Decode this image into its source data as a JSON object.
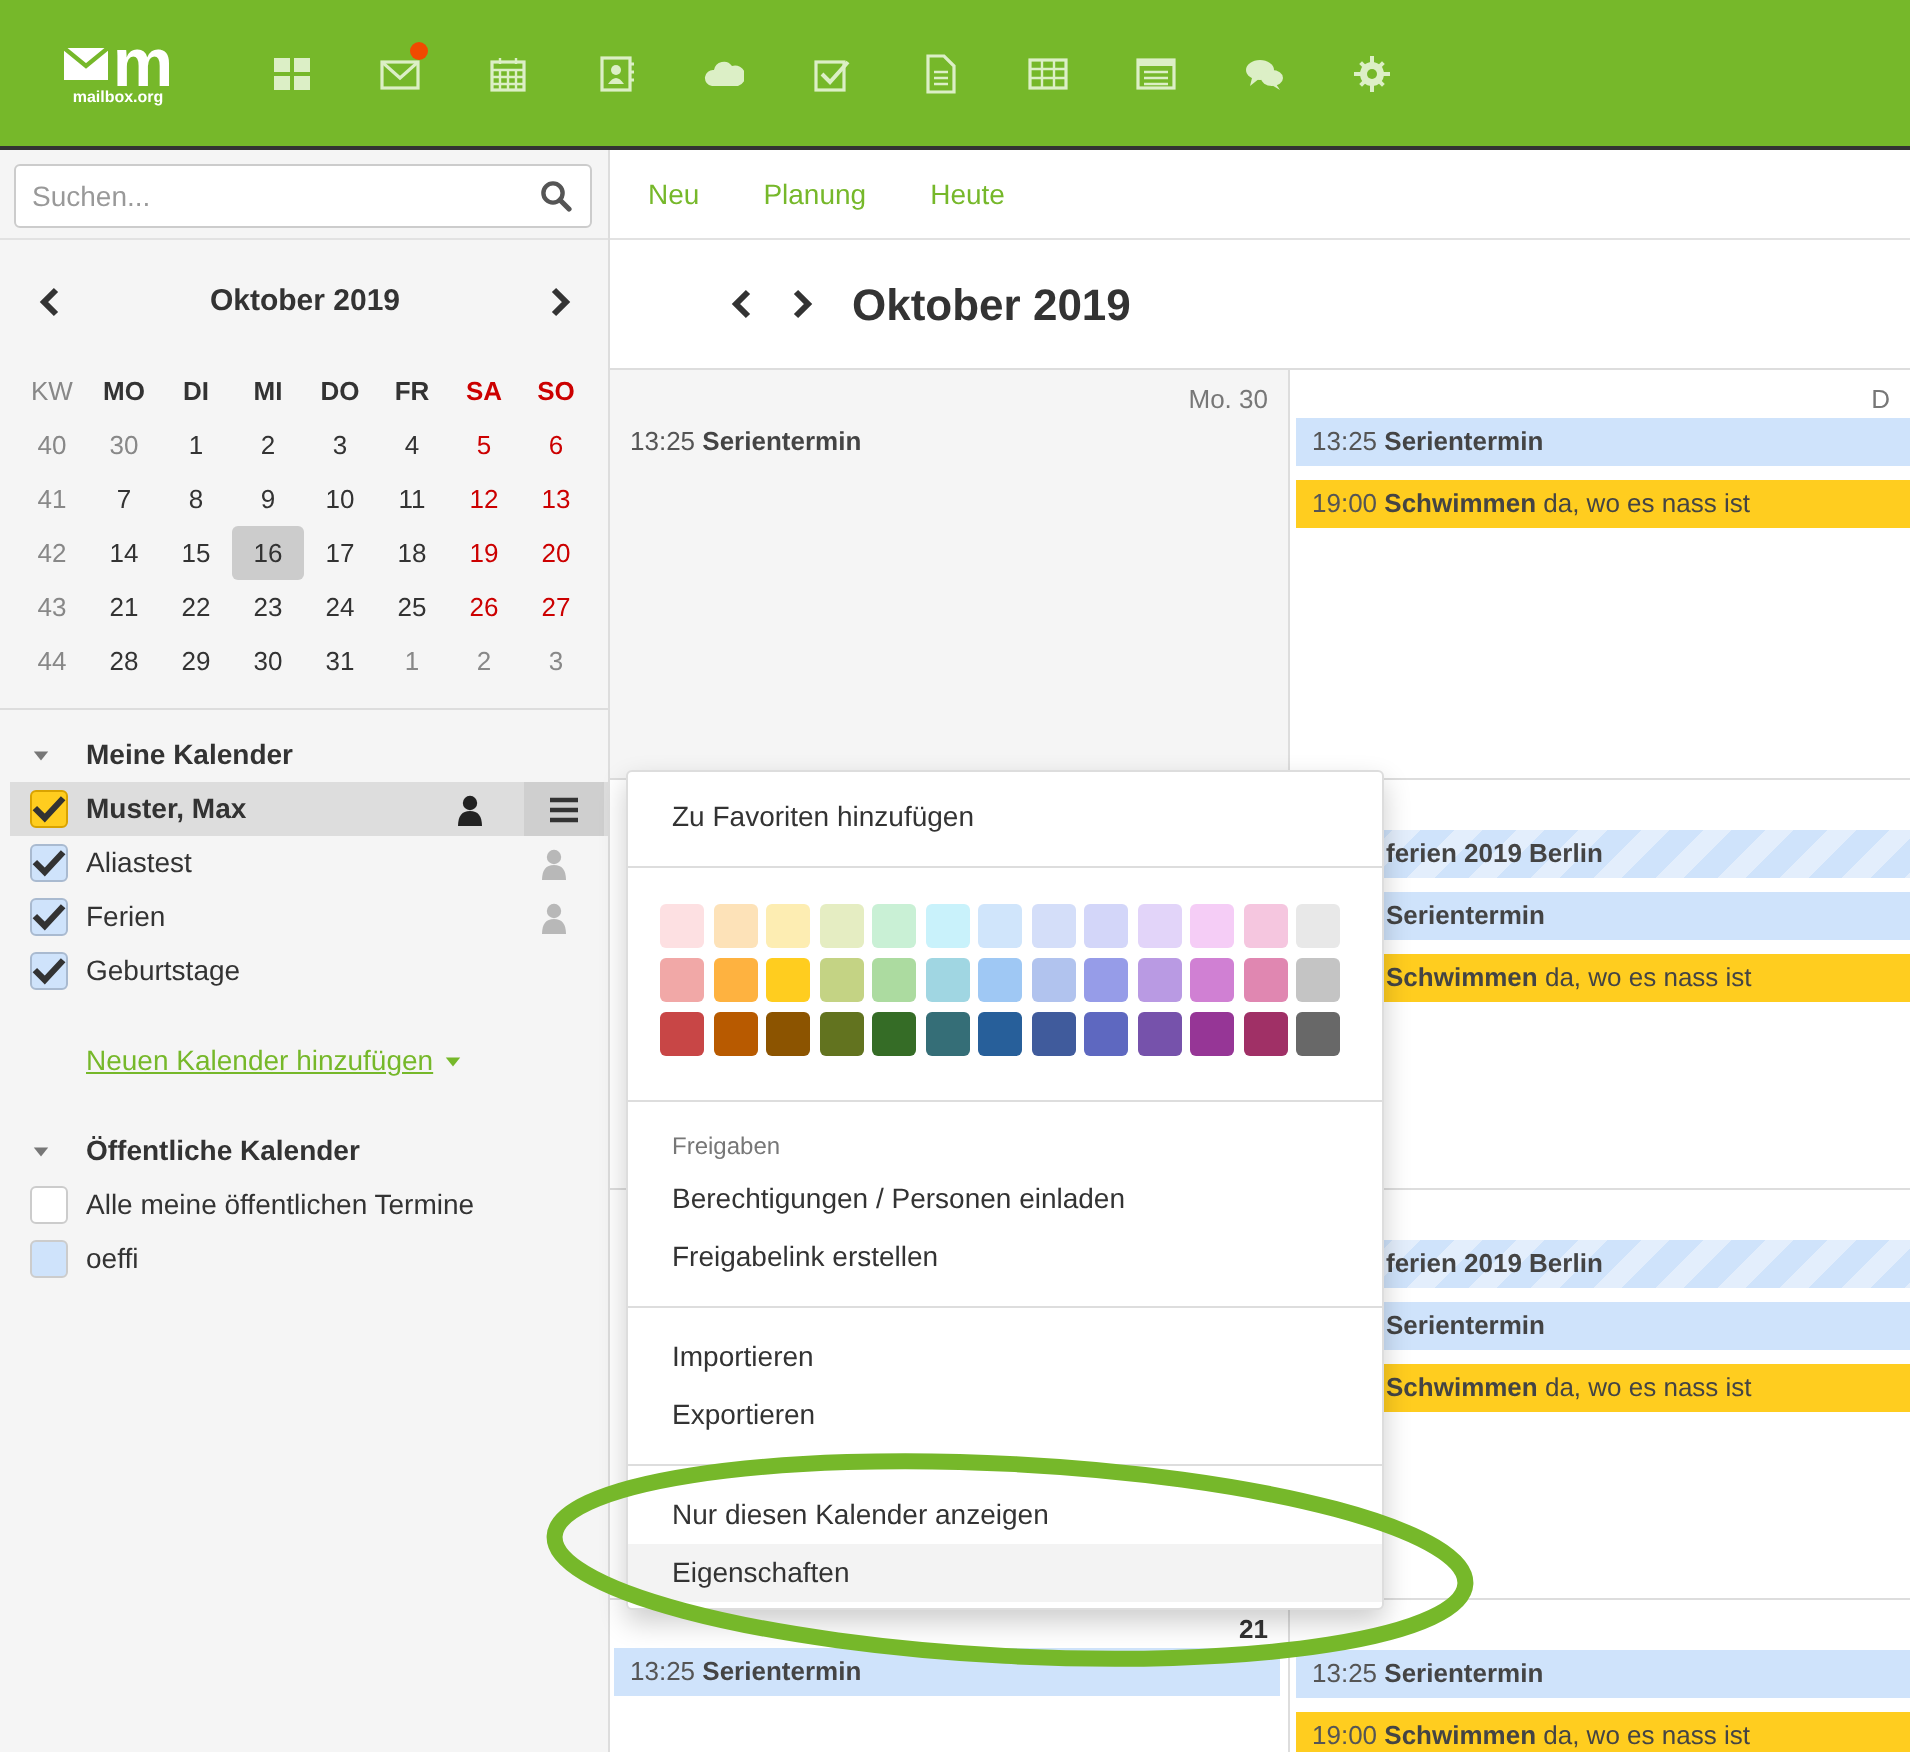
{
  "topbar": {
    "logo": {
      "mark": "m",
      "caption": "mailbox.org"
    },
    "apps": [
      {
        "kind": "portal",
        "notification": false
      },
      {
        "kind": "mail",
        "notification": true
      },
      {
        "kind": "calendar",
        "notification": false
      },
      {
        "kind": "contacts",
        "notification": false
      },
      {
        "kind": "cloud",
        "notification": false
      },
      {
        "kind": "tasks",
        "notification": false
      },
      {
        "kind": "document",
        "notification": false
      },
      {
        "kind": "spreadsheet",
        "notification": false
      },
      {
        "kind": "presentation",
        "notification": false
      },
      {
        "kind": "chat",
        "notification": false
      },
      {
        "kind": "settings",
        "notification": false
      }
    ]
  },
  "sidebar": {
    "search": {
      "placeholder": "Suchen..."
    },
    "minical": {
      "title": "Oktober 2019",
      "columns": [
        {
          "label": "KW",
          "kind": "week"
        },
        {
          "label": "MO",
          "kind": "weekday"
        },
        {
          "label": "DI",
          "kind": "weekday"
        },
        {
          "label": "MI",
          "kind": "weekday"
        },
        {
          "label": "DO",
          "kind": "weekday"
        },
        {
          "label": "FR",
          "kind": "weekday"
        },
        {
          "label": "SA",
          "kind": "weekend"
        },
        {
          "label": "SO",
          "kind": "weekend"
        }
      ],
      "weeks": [
        {
          "number": "40",
          "days": [
            {
              "label": "30",
              "muted": true,
              "selected": false
            },
            {
              "label": "1",
              "muted": false,
              "selected": false
            },
            {
              "label": "2",
              "muted": false,
              "selected": false
            },
            {
              "label": "3",
              "muted": false,
              "selected": false
            },
            {
              "label": "4",
              "muted": false,
              "selected": false
            },
            {
              "label": "5",
              "muted": false,
              "selected": false
            },
            {
              "label": "6",
              "muted": false,
              "selected": false
            }
          ]
        },
        {
          "number": "41",
          "days": [
            {
              "label": "7",
              "muted": false,
              "selected": false
            },
            {
              "label": "8",
              "muted": false,
              "selected": false
            },
            {
              "label": "9",
              "muted": false,
              "selected": false
            },
            {
              "label": "10",
              "muted": false,
              "selected": false
            },
            {
              "label": "11",
              "muted": false,
              "selected": false
            },
            {
              "label": "12",
              "muted": false,
              "selected": false
            },
            {
              "label": "13",
              "muted": false,
              "selected": false
            }
          ]
        },
        {
          "number": "42",
          "days": [
            {
              "label": "14",
              "muted": false,
              "selected": false
            },
            {
              "label": "15",
              "muted": false,
              "selected": false
            },
            {
              "label": "16",
              "muted": false,
              "selected": true
            },
            {
              "label": "17",
              "muted": false,
              "selected": false
            },
            {
              "label": "18",
              "muted": false,
              "selected": false
            },
            {
              "label": "19",
              "muted": false,
              "selected": false
            },
            {
              "label": "20",
              "muted": false,
              "selected": false
            }
          ]
        },
        {
          "number": "43",
          "days": [
            {
              "label": "21",
              "muted": false,
              "selected": false
            },
            {
              "label": "22",
              "muted": false,
              "selected": false
            },
            {
              "label": "23",
              "muted": false,
              "selected": false
            },
            {
              "label": "24",
              "muted": false,
              "selected": false
            },
            {
              "label": "25",
              "muted": false,
              "selected": false
            },
            {
              "label": "26",
              "muted": false,
              "selected": false
            },
            {
              "label": "27",
              "muted": false,
              "selected": false
            }
          ]
        },
        {
          "number": "44",
          "days": [
            {
              "label": "28",
              "muted": false,
              "selected": false
            },
            {
              "label": "29",
              "muted": false,
              "selected": false
            },
            {
              "label": "30",
              "muted": false,
              "selected": false
            },
            {
              "label": "31",
              "muted": false,
              "selected": false
            },
            {
              "label": "1",
              "muted": true,
              "selected": false
            },
            {
              "label": "2",
              "muted": true,
              "selected": false
            },
            {
              "label": "3",
              "muted": true,
              "selected": false
            }
          ]
        }
      ]
    },
    "sections": [
      {
        "title": "Meine Kalender",
        "expanded": true,
        "calendars": [
          {
            "name": "Muster, Max",
            "color": "#ffcd1f",
            "checked": true,
            "selected": true,
            "shared": true
          },
          {
            "name": "Aliastest",
            "color": "#cfe3fb",
            "checked": true,
            "selected": false,
            "shared": true
          },
          {
            "name": "Ferien",
            "color": "#cfe3fb",
            "checked": true,
            "selected": false,
            "shared": true
          },
          {
            "name": "Geburtstage",
            "color": "#cfe3fb",
            "checked": true,
            "selected": false,
            "shared": false
          }
        ],
        "link": "Neuen Kalender hinzufügen"
      },
      {
        "title": "Öffentliche Kalender",
        "expanded": true,
        "calendars": [
          {
            "name": "Alle meine öffentlichen Termine",
            "color": "#ffffff",
            "checked": false,
            "selected": false,
            "shared": false
          },
          {
            "name": "oeffi",
            "color": "#cfe3fb",
            "checked": false,
            "selected": false,
            "shared": false
          }
        ]
      }
    ]
  },
  "main": {
    "toolbar": [
      "Neu",
      "Planung",
      "Heute"
    ],
    "title": "Oktober 2019",
    "weeks": [
      {
        "days": [
          {
            "label": "Mo. 30",
            "kind": "other_month",
            "highlight": false,
            "events": [
              {
                "kind": "appointment",
                "time": "13:25",
                "title": "Serientermin"
              }
            ]
          },
          {
            "label": "D",
            "kind": "month",
            "highlight": false,
            "events": [
              {
                "kind": "appointment",
                "color": "#cfe3fb",
                "time": "13:25",
                "title": "Serientermin"
              },
              {
                "kind": "appointment",
                "color": "#ffcd1f",
                "time": "19:00",
                "title": "Schwimmen",
                "location": "da, wo es nass ist"
              }
            ]
          }
        ]
      },
      {
        "days": [
          {
            "kind": "month"
          },
          {
            "kind": "month",
            "events": [
              {
                "kind": "allday",
                "color": "#cfe3fb",
                "title": "ferien 2019 Berlin"
              },
              {
                "kind": "appointment",
                "color": "#cfe3fb",
                "title": "Serientermin"
              },
              {
                "kind": "appointment",
                "color": "#ffcd1f",
                "title": "Schwimmen",
                "location": "da, wo es nass ist"
              }
            ]
          }
        ]
      },
      {
        "days": [
          {
            "kind": "month"
          },
          {
            "kind": "month",
            "events": [
              {
                "kind": "allday",
                "color": "#cfe3fb",
                "title": "ferien 2019 Berlin"
              },
              {
                "kind": "appointment",
                "color": "#cfe3fb",
                "title": "Serientermin"
              },
              {
                "kind": "appointment",
                "color": "#ffcd1f",
                "title": "Schwimmen",
                "location": "da, wo es nass ist"
              }
            ]
          }
        ]
      },
      {
        "days": [
          {
            "label": "21",
            "kind": "month",
            "highlight": true,
            "events": [
              {
                "kind": "appointment",
                "color": "#cfe3fb",
                "time": "13:25",
                "title": "Serientermin"
              }
            ]
          },
          {
            "kind": "month",
            "events": [
              {
                "kind": "appointment",
                "color": "#cfe3fb",
                "time": "13:25",
                "title": "Serientermin"
              },
              {
                "kind": "appointment",
                "color": "#ffcd1f",
                "time": "19:00",
                "title": "Schwimmen",
                "location": "da, wo es nass ist"
              }
            ]
          }
        ]
      }
    ]
  },
  "context_menu": {
    "entries": [
      {
        "kind": "item",
        "label": "Zu Favoriten hinzufügen",
        "hovered": false
      },
      {
        "kind": "divider"
      },
      {
        "kind": "palette",
        "rows": [
          [
            {
              "color": "#fde0e2"
            },
            {
              "color": "#fde2b8"
            },
            {
              "color": "#fdedb2"
            },
            {
              "color": "#e5edc2"
            },
            {
              "color": "#c9f0d5"
            },
            {
              "color": "#c9f2fb"
            },
            {
              "color": "#d0e5fb"
            },
            {
              "color": "#d4def9"
            },
            {
              "color": "#d3d6f9"
            },
            {
              "color": "#e2d4f9"
            },
            {
              "color": "#f5cdf6"
            },
            {
              "color": "#f5c6df"
            },
            {
              "color": "#e8e8e8"
            }
          ],
          [
            {
              "color": "#f1a8a7"
            },
            {
              "color": "#feb240"
            },
            {
              "color": "#ffcd1f"
            },
            {
              "color": "#c4d384"
            },
            {
              "color": "#acdba0"
            },
            {
              "color": "#a0d6e2"
            },
            {
              "color": "#9fc8f4"
            },
            {
              "color": "#b1c3ee"
            },
            {
              "color": "#969ce8"
            },
            {
              "color": "#b99ae3"
            },
            {
              "color": "#d080d3"
            },
            {
              "color": "#e087b1"
            },
            {
              "color": "#c4c4c4"
            }
          ],
          [
            {
              "color": "#c84646"
            },
            {
              "color": "#b85a00"
            },
            {
              "color": "#8c5400"
            },
            {
              "color": "#62731f"
            },
            {
              "color": "#356c26"
            },
            {
              "color": "#356e77"
            },
            {
              "color": "#275f9a"
            },
            {
              "color": "#405b9c"
            },
            {
              "color": "#5e68c0"
            },
            {
              "color": "#7652ab"
            },
            {
              "color": "#963696"
            },
            {
              "color": "#a03066"
            },
            {
              "color": "#686868"
            }
          ]
        ]
      },
      {
        "kind": "divider"
      },
      {
        "kind": "header",
        "label": "Freigaben"
      },
      {
        "kind": "item",
        "label": "Berechtigungen / Personen einladen",
        "hovered": false
      },
      {
        "kind": "item",
        "label": "Freigabelink erstellen",
        "hovered": false
      },
      {
        "kind": "divider"
      },
      {
        "kind": "item",
        "label": "Importieren",
        "hovered": false
      },
      {
        "kind": "item",
        "label": "Exportieren",
        "hovered": false
      },
      {
        "kind": "divider"
      },
      {
        "kind": "item",
        "label": "Nur diesen Kalender anzeigen",
        "hovered": false
      },
      {
        "kind": "item",
        "label": "Eigenschaften",
        "hovered": true
      }
    ]
  },
  "annotation": {
    "kind": "ellipse"
  }
}
